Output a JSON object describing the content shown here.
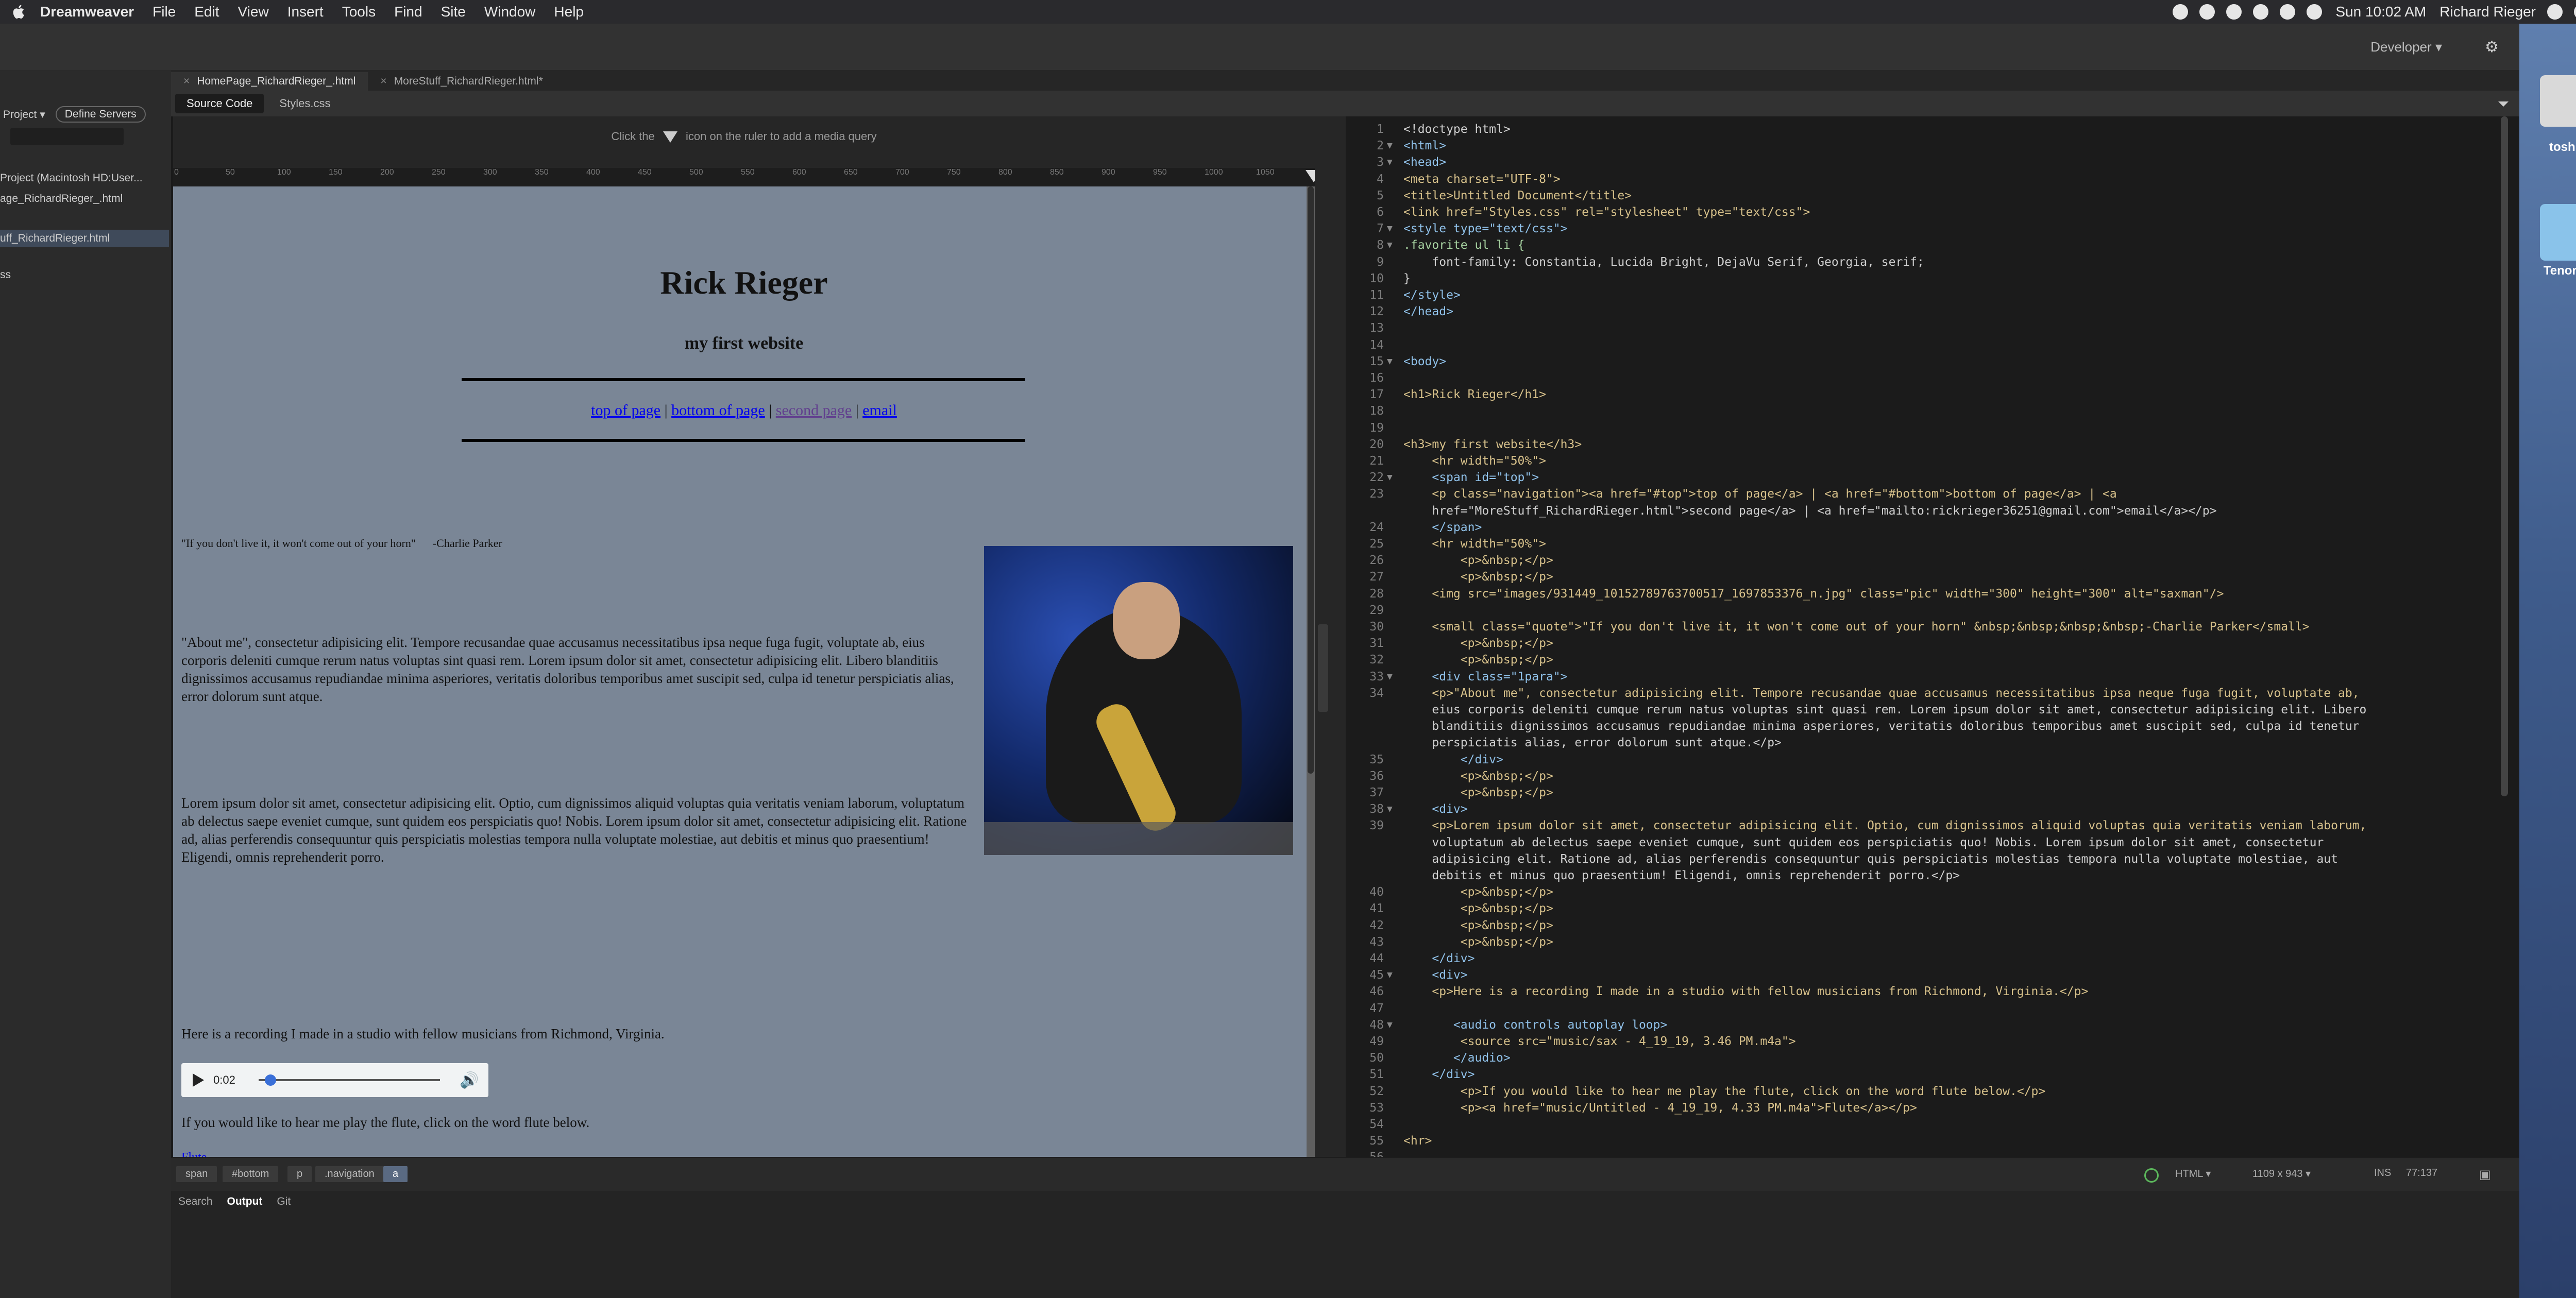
{
  "menubar": {
    "app_name": "Dreamweaver",
    "items": [
      "File",
      "Edit",
      "View",
      "Insert",
      "Tools",
      "Find",
      "Site",
      "Window",
      "Help"
    ],
    "clock": "Sun 10:02 AM",
    "user": "Richard Rieger"
  },
  "workspace": {
    "name": "Developer"
  },
  "files_panel": {
    "project_label": "Project",
    "define_servers_label": "Define Servers",
    "items": [
      "Project (Macintosh HD:User...",
      "age_RichardRieger_.html",
      "uff_RichardRieger.html",
      "ss"
    ]
  },
  "document_tabs": [
    "HomePage_RichardRieger_.html",
    "MoreStuff_RichardRieger.html*"
  ],
  "related_files": [
    "Source Code",
    "Styles.css"
  ],
  "media_query_hint": {
    "before": "Click the",
    "after": "icon on the ruler to add a media query"
  },
  "ruler_ticks": [
    "0",
    "50",
    "100",
    "150",
    "200",
    "250",
    "300",
    "350",
    "400",
    "450",
    "500",
    "550",
    "600",
    "650",
    "700",
    "750",
    "800",
    "850",
    "900",
    "950",
    "1000",
    "1050"
  ],
  "live_view": {
    "heading": "Rick Rieger",
    "subheading": "my first website",
    "nav_top": "top of page",
    "nav_bottom": "bottom of page",
    "nav_second": "second page",
    "nav_email": "email",
    "nav_sep": "|",
    "quote": "\"If you don't live it, it won't come out of your horn\"      -Charlie Parker",
    "about_para": "\"About me\", consectetur adipisicing elit. Tempore recusandae quae accusamus necessitatibus ipsa neque fuga fugit, voluptate ab, eius corporis deleniti cumque rerum natus voluptas sint quasi rem. Lorem ipsum dolor sit amet, consectetur adipisicing elit. Libero blanditiis dignissimos accusamus repudiandae minima asperiores, veritatis doloribus temporibus amet suscipit sed, culpa id tenetur perspiciatis alias, error dolorum sunt atque.",
    "lorem_para": "Lorem ipsum dolor sit amet, consectetur adipisicing elit. Optio, cum dignissimos aliquid voluptas quia veritatis veniam laborum, voluptatum ab delectus saepe eveniet cumque, sunt quidem eos perspiciatis quo! Nobis. Lorem ipsum dolor sit amet, consectetur adipisicing elit. Ratione ad, alias perferendis consequuntur quis perspiciatis molestias tempora nulla voluptate molestiae, aut debitis et minus quo praesentium! Eligendi, omnis reprehenderit porro.",
    "recording_text": "Here is a recording I made in a studio with fellow musicians from Richmond, Virginia.",
    "audio_time": "0:02",
    "flute_text": "If you would like to hear me play the flute, click on the word flute below.",
    "flute_link": "Flute"
  },
  "code_lines": [
    {
      "n": "1",
      "fold": "",
      "t": "<!doctype html>"
    },
    {
      "n": "2",
      "fold": "▼",
      "t": "<html>"
    },
    {
      "n": "3",
      "fold": "▼",
      "t": "<head>"
    },
    {
      "n": "4",
      "fold": "",
      "t": "<meta charset=\"UTF-8\">"
    },
    {
      "n": "5",
      "fold": "",
      "t": "<title>Untitled Document</title>"
    },
    {
      "n": "6",
      "fold": "",
      "t": "<link href=\"Styles.css\" rel=\"stylesheet\" type=\"text/css\">"
    },
    {
      "n": "7",
      "fold": "▼",
      "t": "<style type=\"text/css\">"
    },
    {
      "n": "8",
      "fold": "▼",
      "t": ".favorite ul li {"
    },
    {
      "n": "9",
      "fold": "",
      "t": "    font-family: Constantia, Lucida Bright, DejaVu Serif, Georgia, serif;"
    },
    {
      "n": "10",
      "fold": "",
      "t": "}"
    },
    {
      "n": "11",
      "fold": "",
      "t": "</style>"
    },
    {
      "n": "12",
      "fold": "",
      "t": "</head>"
    },
    {
      "n": "13",
      "fold": "",
      "t": ""
    },
    {
      "n": "14",
      "fold": "",
      "t": ""
    },
    {
      "n": "15",
      "fold": "▼",
      "t": "<body>"
    },
    {
      "n": "16",
      "fold": "",
      "t": ""
    },
    {
      "n": "17",
      "fold": "",
      "t": "<h1>Rick Rieger</h1>"
    },
    {
      "n": "18",
      "fold": "",
      "t": ""
    },
    {
      "n": "19",
      "fold": "",
      "t": ""
    },
    {
      "n": "20",
      "fold": "",
      "t": "<h3>my first website</h3>"
    },
    {
      "n": "21",
      "fold": "",
      "t": "    <hr width=\"50%\">"
    },
    {
      "n": "22",
      "fold": "▼",
      "t": "    <span id=\"top\">"
    },
    {
      "n": "23",
      "fold": "",
      "t": "    <p class=\"navigation\"><a href=\"#top\">top of page</a> | <a href=\"#bottom\">bottom of page</a> | <a"
    },
    {
      "n": "",
      "fold": "",
      "t": "    href=\"MoreStuff_RichardRieger.html\">second page</a> | <a href=\"mailto:rickrieger36251@gmail.com\">email</a></p>"
    },
    {
      "n": "24",
      "fold": "",
      "t": "    </span>"
    },
    {
      "n": "25",
      "fold": "",
      "t": "    <hr width=\"50%\">"
    },
    {
      "n": "26",
      "fold": "",
      "t": "        <p>&nbsp;</p>"
    },
    {
      "n": "27",
      "fold": "",
      "t": "        <p>&nbsp;</p>"
    },
    {
      "n": "28",
      "fold": "",
      "t": "    <img src=\"images/931449_10152789763700517_1697853376_n.jpg\" class=\"pic\" width=\"300\" height=\"300\" alt=\"saxman\"/>"
    },
    {
      "n": "29",
      "fold": "",
      "t": ""
    },
    {
      "n": "30",
      "fold": "",
      "t": "    <small class=\"quote\">\"If you don't live it, it won't come out of your horn\" &nbsp;&nbsp;&nbsp;&nbsp;-Charlie Parker</small>"
    },
    {
      "n": "31",
      "fold": "",
      "t": "        <p>&nbsp;</p>"
    },
    {
      "n": "32",
      "fold": "",
      "t": "        <p>&nbsp;</p>"
    },
    {
      "n": "33",
      "fold": "▼",
      "t": "    <div class=\"1para\">"
    },
    {
      "n": "34",
      "fold": "",
      "t": "    <p>\"About me\", consectetur adipisicing elit. Tempore recusandae quae accusamus necessitatibus ipsa neque fuga fugit, voluptate ab,"
    },
    {
      "n": "",
      "fold": "",
      "t": "    eius corporis deleniti cumque rerum natus voluptas sint quasi rem. Lorem ipsum dolor sit amet, consectetur adipisicing elit. Libero"
    },
    {
      "n": "",
      "fold": "",
      "t": "    blanditiis dignissimos accusamus repudiandae minima asperiores, veritatis doloribus temporibus amet suscipit sed, culpa id tenetur"
    },
    {
      "n": "",
      "fold": "",
      "t": "    perspiciatis alias, error dolorum sunt atque.</p>"
    },
    {
      "n": "35",
      "fold": "",
      "t": "        </div>"
    },
    {
      "n": "36",
      "fold": "",
      "t": "        <p>&nbsp;</p>"
    },
    {
      "n": "37",
      "fold": "",
      "t": "        <p>&nbsp;</p>"
    },
    {
      "n": "38",
      "fold": "▼",
      "t": "    <div>"
    },
    {
      "n": "39",
      "fold": "",
      "t": "    <p>Lorem ipsum dolor sit amet, consectetur adipisicing elit. Optio, cum dignissimos aliquid voluptas quia veritatis veniam laborum,"
    },
    {
      "n": "",
      "fold": "",
      "t": "    voluptatum ab delectus saepe eveniet cumque, sunt quidem eos perspiciatis quo! Nobis. Lorem ipsum dolor sit amet, consectetur"
    },
    {
      "n": "",
      "fold": "",
      "t": "    adipisicing elit. Ratione ad, alias perferendis consequuntur quis perspiciatis molestias tempora nulla voluptate molestiae, aut"
    },
    {
      "n": "",
      "fold": "",
      "t": "    debitis et minus quo praesentium! Eligendi, omnis reprehenderit porro.</p>"
    },
    {
      "n": "40",
      "fold": "",
      "t": "        <p>&nbsp;</p>"
    },
    {
      "n": "41",
      "fold": "",
      "t": "        <p>&nbsp;</p>"
    },
    {
      "n": "42",
      "fold": "",
      "t": "        <p>&nbsp;</p>"
    },
    {
      "n": "43",
      "fold": "",
      "t": "        <p>&nbsp;</p>"
    },
    {
      "n": "44",
      "fold": "",
      "t": "    </div>"
    },
    {
      "n": "45",
      "fold": "▼",
      "t": "    <div>"
    },
    {
      "n": "46",
      "fold": "",
      "t": "    <p>Here is a recording I made in a studio with fellow musicians from Richmond, Virginia.</p>"
    },
    {
      "n": "47",
      "fold": "",
      "t": ""
    },
    {
      "n": "48",
      "fold": "▼",
      "t": "       <audio controls autoplay loop>"
    },
    {
      "n": "49",
      "fold": "",
      "t": "        <source src=\"music/sax - 4_19_19, 3.46 PM.m4a\">"
    },
    {
      "n": "50",
      "fold": "",
      "t": "       </audio>"
    },
    {
      "n": "51",
      "fold": "",
      "t": "    </div>"
    },
    {
      "n": "52",
      "fold": "",
      "t": "        <p>If you would like to hear me play the flute, click on the word flute below.</p>"
    },
    {
      "n": "53",
      "fold": "",
      "t": "        <p><a href=\"music/Untitled - 4_19_19, 4.33 PM.m4a\">Flute</a></p>"
    },
    {
      "n": "54",
      "fold": "",
      "t": ""
    },
    {
      "n": "55",
      "fold": "",
      "t": "<hr>"
    },
    {
      "n": "56",
      "fold": "",
      "t": ""
    }
  ],
  "status": {
    "crumbs": [
      "span",
      "#bottom",
      "p",
      ".navigation",
      "a"
    ],
    "doc_type": "HTML",
    "size": "1109 x 943",
    "mode": "INS",
    "position": "77:137"
  },
  "output_tabs": [
    "Search",
    "Output",
    "Git"
  ],
  "desktop": {
    "drive_label": "tosh HD",
    "folder_label": "Tenor Sax"
  }
}
